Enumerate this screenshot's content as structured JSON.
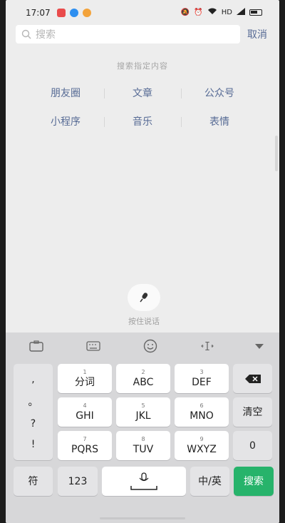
{
  "status_bar": {
    "time": "17:07",
    "network": "HD"
  },
  "search": {
    "placeholder": "搜索",
    "cancel_label": "取消"
  },
  "hint": "搜索指定内容",
  "categories": [
    [
      "朋友圈",
      "文章",
      "公众号"
    ],
    [
      "小程序",
      "音乐",
      "表情"
    ]
  ],
  "voice": {
    "label": "按住说话"
  },
  "keyboard": {
    "symbols": [
      ",",
      "。",
      "?",
      "!"
    ],
    "keys": [
      {
        "num": "1",
        "label": "分词"
      },
      {
        "num": "2",
        "label": "ABC"
      },
      {
        "num": "3",
        "label": "DEF"
      },
      {
        "num": "4",
        "label": "GHI"
      },
      {
        "num": "5",
        "label": "JKL"
      },
      {
        "num": "6",
        "label": "MNO"
      },
      {
        "num": "7",
        "label": "PQRS"
      },
      {
        "num": "8",
        "label": "TUV"
      },
      {
        "num": "9",
        "label": "WXYZ"
      }
    ],
    "clear_label": "清空",
    "zero_label": "0",
    "symbol_label": "符",
    "num_label": "123",
    "lang_label": "中/英",
    "search_label": "搜索"
  },
  "colors": {
    "accent": "#576b95",
    "search_key": "#27b36b"
  }
}
